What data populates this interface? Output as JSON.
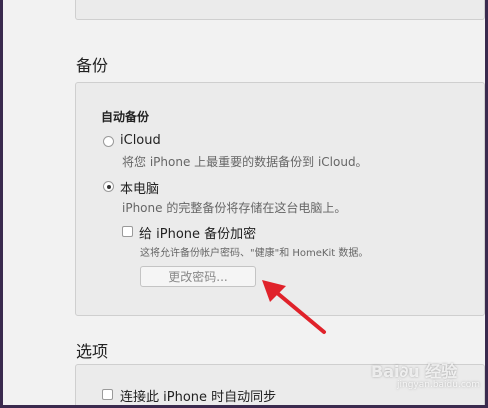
{
  "sections": {
    "backup_title": "备份",
    "options_title": "选项"
  },
  "backup": {
    "auto_backup_label": "自动备份",
    "icloud": {
      "label": "iCloud",
      "description": "将您 iPhone 上最重要的数据备份到 iCloud。",
      "selected": false
    },
    "this_computer": {
      "label": "本电脑",
      "description": "iPhone 的完整备份将存储在这台电脑上。",
      "selected": true
    },
    "encrypt": {
      "label": "给 iPhone 备份加密",
      "description": "这将允许备份帐户密码、\"健康\"和 HomeKit 数据。",
      "checked": false
    },
    "change_password_button": "更改密码..."
  },
  "options": {
    "sync_label": "连接此 iPhone 时自动同步",
    "sync_checked": false
  },
  "watermark": {
    "text": "Bai∂u 经验",
    "sub": "jingyan.baidu.com"
  },
  "colors": {
    "frame": "#3a2a4e",
    "panel": "#ebebeb",
    "arrow": "#e0222a"
  }
}
